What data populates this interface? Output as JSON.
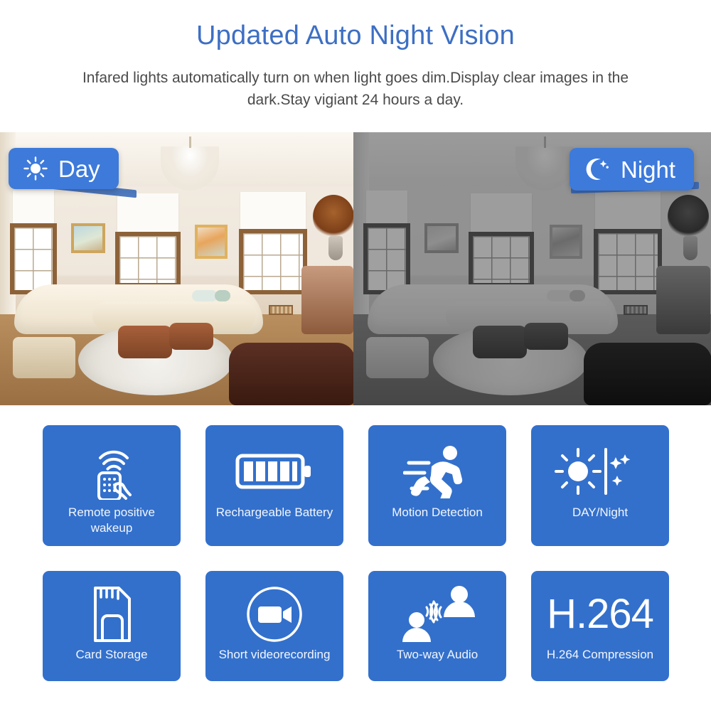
{
  "header": {
    "title": "Updated Auto Night Vision",
    "subtitle": "Infared lights automatically turn on when light goes dim.Display clear images in the dark.Stay vigiant 24 hours a day.",
    "title_color": "#3d6fc4",
    "subtitle_color": "#4a4a4a"
  },
  "comparison": {
    "day_badge": {
      "label": "Day",
      "icon": "sun-icon",
      "background": "#3d7ada",
      "text_color": "#ffffff"
    },
    "night_badge": {
      "label": "Night",
      "icon": "moon-stars-icon",
      "background": "#3d7ada",
      "text_color": "#ffffff"
    },
    "day_scene_alt": "Living room in daylight with curved cream sectional sofa, chandelier, windows and round rug",
    "night_scene_alt": "Same living room in grayscale night vision view"
  },
  "features": {
    "tile_color": "#3370cc",
    "label_color": "#f2f6fc",
    "row1": [
      {
        "label": "Remote positive wakeup",
        "icon": "remote-control-icon"
      },
      {
        "label": "Rechargeable Battery",
        "icon": "battery-icon"
      },
      {
        "label": "Motion Detection",
        "icon": "running-person-icon"
      },
      {
        "label": "DAY/Night",
        "icon": "sun-moon-icon"
      }
    ],
    "row2": [
      {
        "label": "Card Storage",
        "icon": "sd-card-icon"
      },
      {
        "label": "Short videorecording",
        "icon": "video-camera-icon"
      },
      {
        "label": "Two-way Audio",
        "icon": "two-way-audio-icon"
      },
      {
        "label": "H.264 Compression",
        "icon": "h264-text",
        "big_text": "H.264"
      }
    ]
  }
}
